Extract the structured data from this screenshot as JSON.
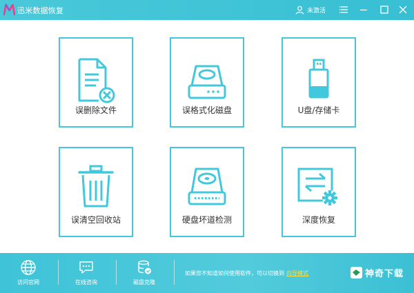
{
  "window": {
    "title": "迅米数据恢复",
    "user_label": "未激活"
  },
  "tiles": [
    {
      "label": "误删除文件",
      "icon": "deleted-file-icon"
    },
    {
      "label": "误格式化磁盘",
      "icon": "formatted-disk-icon"
    },
    {
      "label": "U盘/存储卡",
      "icon": "usb-drive-icon"
    },
    {
      "label": "误清空回收站",
      "icon": "recycle-bin-icon"
    },
    {
      "label": "硬盘坏道检测",
      "icon": "disk-check-icon"
    },
    {
      "label": "深度恢复",
      "icon": "deep-recovery-icon"
    }
  ],
  "bottom": {
    "items": [
      {
        "label": "访问官网",
        "icon": "globe-icon"
      },
      {
        "label": "在线咨询",
        "icon": "chat-icon"
      },
      {
        "label": "磁盘克隆",
        "icon": "disk-clone-icon"
      }
    ],
    "notice": "如果您不知道如何使用软件，可以切换到",
    "notice_link": "向导模式",
    "brand": "神奇下载"
  },
  "colors": {
    "accent": "#41c8dc",
    "title_bar": "#45c6d8",
    "link": "#ffe03a"
  }
}
